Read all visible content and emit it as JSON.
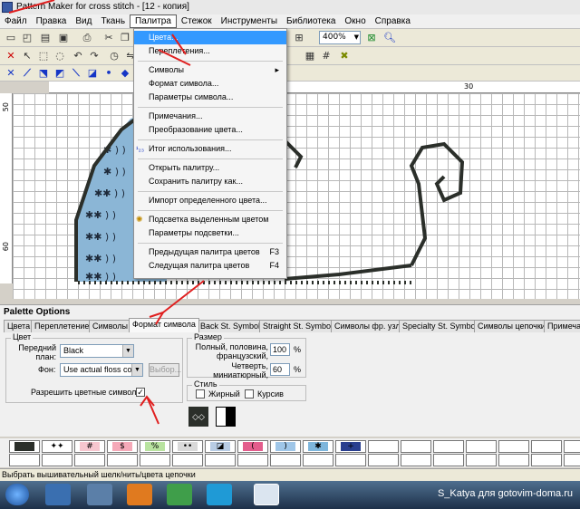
{
  "window": {
    "title": "Pattern Maker for cross stitch - [12 - копия]"
  },
  "menubar": [
    "Файл",
    "Правка",
    "Вид",
    "Ткань",
    "Палитра",
    "Стежок",
    "Инструменты",
    "Библиотека",
    "Окно",
    "Справка"
  ],
  "toolbar": {
    "zoom": "400%"
  },
  "ruler": {
    "top_label": "30",
    "left_labels": [
      "50",
      "60"
    ]
  },
  "dropdown": {
    "items": [
      {
        "label": "Цвета...",
        "shortcut": "",
        "highlighted": true
      },
      {
        "label": "Переплетения...",
        "shortcut": ""
      },
      {
        "label": "Символы",
        "shortcut": "▸"
      },
      {
        "label": "Формат символа...",
        "shortcut": ""
      },
      {
        "label": "Параметры символа...",
        "shortcut": ""
      },
      {
        "label": "Примечания...",
        "shortcut": ""
      },
      {
        "label": "Преобразование цвета...",
        "shortcut": ""
      },
      {
        "label": "Итог использования...",
        "shortcut": ""
      },
      {
        "label": "Открыть палитру...",
        "shortcut": ""
      },
      {
        "label": "Сохранить палитру как...",
        "shortcut": ""
      },
      {
        "label": "Импорт определенного цвета...",
        "shortcut": ""
      },
      {
        "label": "Подсветка выделенным цветом",
        "shortcut": ""
      },
      {
        "label": "Параметры подсветки...",
        "shortcut": ""
      },
      {
        "label": "Предыдущая палитра цветов",
        "shortcut": "F3"
      },
      {
        "label": "Следущая палитра цветов",
        "shortcut": "F4"
      }
    ]
  },
  "palette_options": {
    "title": "Palette Options",
    "tabs": [
      "Цвета",
      "Переплетение",
      "Символы",
      "Формат символа",
      "Back St. Symbols",
      "Straight St. Symbols",
      "Символы фр. узла",
      "Specialty St. Symbols",
      "Символы цепочки",
      "Примечания"
    ],
    "active_tab": "Формат символа",
    "color_group": {
      "label": "Цвет",
      "foreground_label": "Передний план:",
      "foreground_value": "Black",
      "background_label": "Фон:",
      "background_value": "Use actual floss color",
      "choose_button": "Выбор...",
      "allow_colored_symbols": "Разрешить цветные символы",
      "allow_checked": "✓"
    },
    "size_group": {
      "label": "Размер",
      "full_label": "Полный, половина, французский,",
      "full_value": "100",
      "quarter_label": "Четверть, миниатюрный,",
      "quarter_value": "60",
      "percent": "%"
    },
    "style_group": {
      "label": "Стиль",
      "bold": "Жирный",
      "italic": "Курсив"
    }
  },
  "palette_swatches": [
    {
      "symbol": "",
      "color": "#2b2f2a"
    },
    {
      "symbol": "✦✦",
      "color": "#ffffff"
    },
    {
      "symbol": "#",
      "color": "#f7c6cf"
    },
    {
      "symbol": "$",
      "color": "#f5a9b8"
    },
    {
      "symbol": "%",
      "color": "#b9e3a0"
    },
    {
      "symbol": "••",
      "color": "#d9d9d9"
    },
    {
      "symbol": "◪",
      "color": "#b8cce4"
    },
    {
      "symbol": "(",
      "color": "#e35d8c"
    },
    {
      "symbol": ")",
      "color": "#9fc6e8"
    },
    {
      "symbol": "✱",
      "color": "#7eb6dc"
    },
    {
      "symbol": "+",
      "color": "#2a3f8f"
    }
  ],
  "statusbar": {
    "text": "Выбрать вышивательный шелк/нить/цвета цепочки"
  },
  "watermark": "S_Katya для gotovim-doma.ru",
  "colors": {
    "highlight": "#3399ff",
    "annotation": "#e02020",
    "stitch_blue": "#8bb6d6",
    "outline": "#2b2f2a"
  }
}
